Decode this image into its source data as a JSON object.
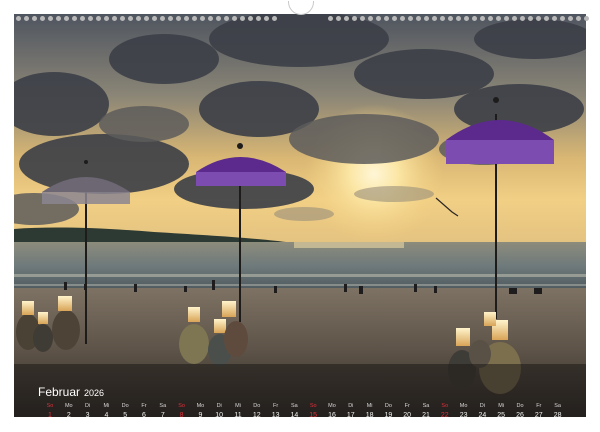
{
  "calendar": {
    "month": "Februar",
    "year": "2026",
    "days": [
      {
        "weekday": "So",
        "day": "1",
        "sunday": true
      },
      {
        "weekday": "Mo",
        "day": "2"
      },
      {
        "weekday": "Di",
        "day": "3"
      },
      {
        "weekday": "Mi",
        "day": "4"
      },
      {
        "weekday": "Do",
        "day": "5"
      },
      {
        "weekday": "Fr",
        "day": "6"
      },
      {
        "weekday": "Sa",
        "day": "7"
      },
      {
        "weekday": "So",
        "day": "8",
        "sunday": true
      },
      {
        "weekday": "Mo",
        "day": "9"
      },
      {
        "weekday": "Di",
        "day": "10"
      },
      {
        "weekday": "Mi",
        "day": "11"
      },
      {
        "weekday": "Do",
        "day": "12"
      },
      {
        "weekday": "Fr",
        "day": "13"
      },
      {
        "weekday": "Sa",
        "day": "14"
      },
      {
        "weekday": "So",
        "day": "15",
        "sunday": true
      },
      {
        "weekday": "Mo",
        "day": "16"
      },
      {
        "weekday": "Di",
        "day": "17"
      },
      {
        "weekday": "Mi",
        "day": "18"
      },
      {
        "weekday": "Do",
        "day": "19"
      },
      {
        "weekday": "Fr",
        "day": "20"
      },
      {
        "weekday": "Sa",
        "day": "21"
      },
      {
        "weekday": "So",
        "day": "22",
        "sunday": true
      },
      {
        "weekday": "Mo",
        "day": "23"
      },
      {
        "weekday": "Di",
        "day": "24"
      },
      {
        "weekday": "Mi",
        "day": "25"
      },
      {
        "weekday": "Do",
        "day": "26"
      },
      {
        "weekday": "Fr",
        "day": "27"
      },
      {
        "weekday": "Sa",
        "day": "28"
      }
    ]
  },
  "colors": {
    "sunday": "#e0303a",
    "umbrella": "#5b2a8c",
    "sky_glow": "#f7d27a"
  },
  "icons": [
    "binding-hole",
    "hanger-hook",
    "umbrella",
    "lantern",
    "kite"
  ]
}
